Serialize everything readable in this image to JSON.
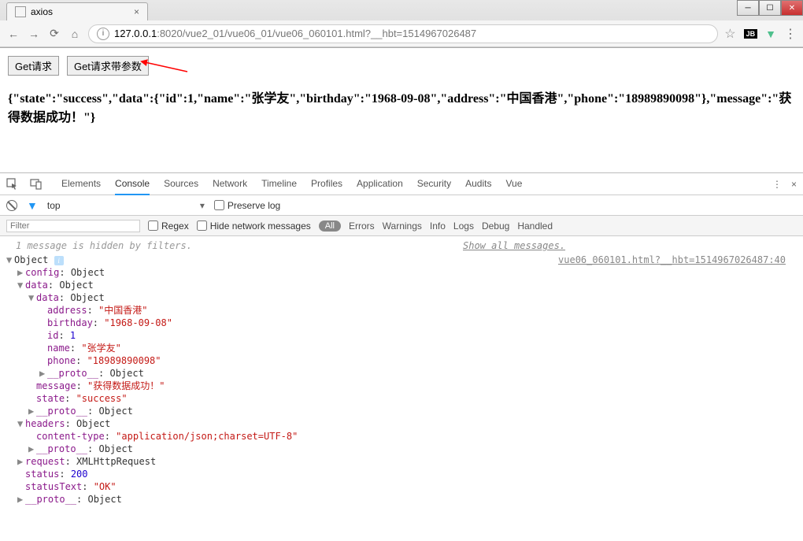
{
  "browser": {
    "tab_title": "axios",
    "url_host": "127.0.0.1",
    "url_port": ":8020",
    "url_path": "/vue2_01/vue06_01/vue06_060101.html?__hbt=1514967026487"
  },
  "page": {
    "btn_get": "Get请求",
    "btn_get_params": "Get请求带参数",
    "json_output": "{\"state\":\"success\",\"data\":{\"id\":1,\"name\":\"张学友\",\"birthday\":\"1968-09-08\",\"address\":\"中国香港\",\"phone\":\"18989890098\"},\"message\":\"获得数据成功！\"}"
  },
  "devtools": {
    "tabs": [
      "Elements",
      "Console",
      "Sources",
      "Network",
      "Timeline",
      "Profiles",
      "Application",
      "Security",
      "Audits",
      "Vue"
    ],
    "active_tab": "Console",
    "context": "top",
    "preserve_log": "Preserve log",
    "filter_placeholder": "Filter",
    "regex": "Regex",
    "hide_network": "Hide network messages",
    "pill_all": "All",
    "filter_levels": [
      "Errors",
      "Warnings",
      "Info",
      "Logs",
      "Debug",
      "Handled"
    ],
    "hidden_msg": "1 message is hidden by filters.",
    "show_all": "Show all messages.",
    "source_link": "vue06_060101.html?__hbt=1514967026487:40"
  },
  "console_object": {
    "root": "Object",
    "config_key": "config",
    "config_val": "Object",
    "data_key": "data",
    "data_val": "Object",
    "inner": {
      "data_key": "data",
      "data_val": "Object",
      "address_key": "address",
      "address_val": "\"中国香港\"",
      "birthday_key": "birthday",
      "birthday_val": "\"1968-09-08\"",
      "id_key": "id",
      "id_val": "1",
      "name_key": "name",
      "name_val": "\"张学友\"",
      "phone_key": "phone",
      "phone_val": "\"18989890098\"",
      "proto_key": "__proto__",
      "proto_val": "Object",
      "message_key": "message",
      "message_val": "\"获得数据成功！\"",
      "state_key": "state",
      "state_val": "\"success\""
    },
    "headers_key": "headers",
    "headers_val": "Object",
    "content_type_key": "content-type",
    "content_type_val": "\"application/json;charset=UTF-8\"",
    "request_key": "request",
    "request_val": "XMLHttpRequest",
    "status_key": "status",
    "status_val": "200",
    "statusText_key": "statusText",
    "statusText_val": "\"OK\""
  }
}
